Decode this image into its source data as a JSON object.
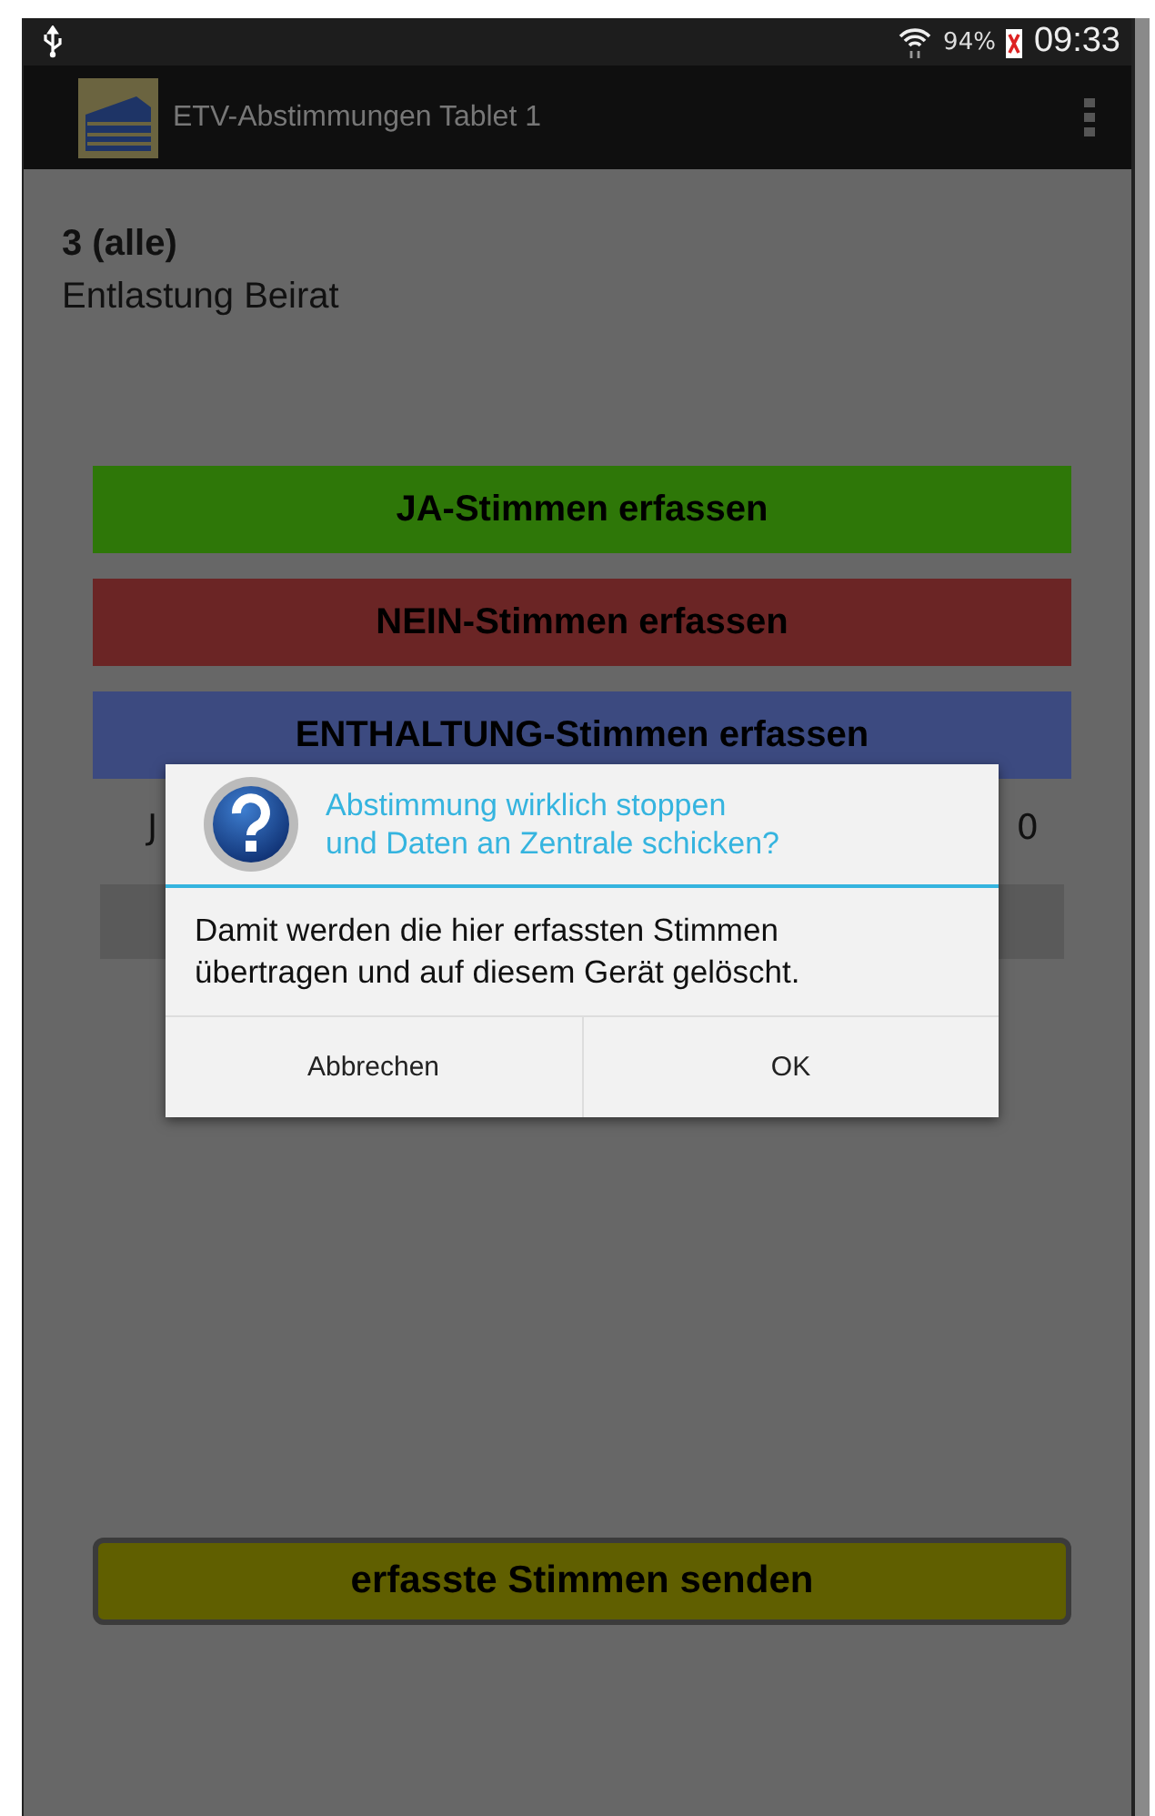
{
  "status_bar": {
    "battery": "94%",
    "time": "09:33"
  },
  "action_bar": {
    "title": "ETV-Abstimmungen Tablet 1"
  },
  "agenda_item": {
    "number": "3 (alle)",
    "title": "Entlastung Beirat"
  },
  "vote_buttons": [
    {
      "label": "JA-Stimmen erfassen",
      "color": "#2e7708"
    },
    {
      "label": "NEIN-Stimmen erfassen",
      "color": "#6b2525"
    },
    {
      "label": "ENTHALTUNG-Stimmen erfassen",
      "color": "#3c4a80"
    }
  ],
  "hidden_row": {
    "start": "J",
    "end": "0"
  },
  "send_button": {
    "label": "erfasste Stimmen senden"
  },
  "dialog": {
    "title": "Abstimmung wirklich stoppen\nund Daten an Zentrale schicken?",
    "message": "Damit werden die hier erfassten Stimmen übertragen und auf diesem Gerät gelöscht.",
    "buttons": [
      "Abbrechen",
      "OK"
    ]
  }
}
